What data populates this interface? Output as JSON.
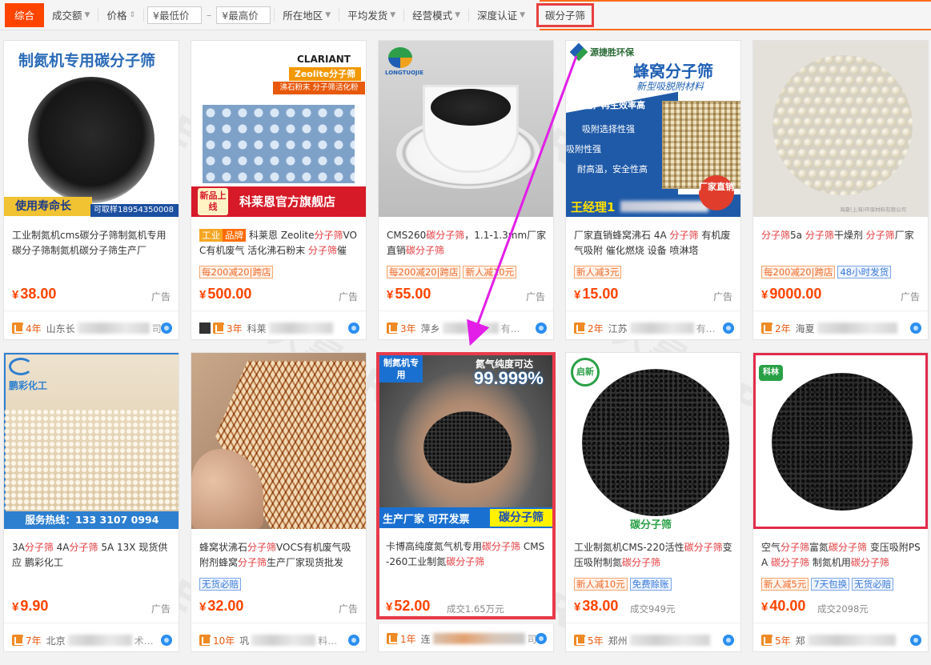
{
  "filter_bar": {
    "items": [
      "综合",
      "成交额",
      "价格"
    ],
    "min_price": "¥最低价",
    "max_price": "¥最高价",
    "location": "所在地区",
    "shipping": "平均发货",
    "business": "经营模式",
    "certification": "深度认证",
    "keyword": "碳分子筛"
  },
  "watermark": "大昇ERP",
  "products": [
    {
      "img_caption": "制氮机专用碳分子筛",
      "img_banner": "使用寿命长",
      "img_banner2": "可取样18954350008",
      "title_parts": [
        "工业制氮机cms碳分子筛制氮机专用碳分子筛制氮机碳分子筛生产厂"
      ],
      "tags": [],
      "price": "38.00",
      "deal": "",
      "ad": "广告",
      "years": "4年",
      "seller": "山东长"
    },
    {
      "img_brand": "CLARIANT",
      "img_sub": "Zeolite分子筛",
      "img_sub2": "沸石粉末 分子筛活化粉",
      "img_badge": "新品上线",
      "img_store": "科莱恩官方旗舰店",
      "title_prefix_tags": [
        "工业",
        "品牌"
      ],
      "title_parts": [
        "科莱恩 Zeolite",
        "分子筛",
        "VOC有机废气 活化沸石粉末 ",
        "分子筛",
        "催"
      ],
      "tags": [
        {
          "text": "每200减20|跨店",
          "style": "orange"
        }
      ],
      "price": "500.00",
      "deal": "",
      "ad": "广告",
      "years": "3年",
      "seller": "科莱"
    },
    {
      "img_logo": "LONGTUOJIE",
      "title_parts": [
        "CMS260",
        "碳分子筛",
        "，1.1-1.3mm厂家直销",
        "碳分子筛"
      ],
      "tags": [
        {
          "text": "每200减20|跨店",
          "style": "orange"
        },
        {
          "text": "新人减10元",
          "style": "orange"
        }
      ],
      "price": "55.00",
      "deal": "",
      "ad": "广告",
      "years": "3年",
      "seller": "萍乡",
      "seller_tail": "有…"
    },
    {
      "img_brand": "源捷胜环保",
      "img_title": "蜂窝分子筛",
      "img_sub": "新型吸脱附材料",
      "img_lines": [
        "热再生，再生效率高",
        "吸附选择性强",
        "吸附性强",
        "耐高温，安全性高"
      ],
      "img_contact": "王经理1",
      "img_badge": "厂家直销",
      "title_parts": [
        "厂家直销蜂窝沸石 4A ",
        "分子筛",
        " 有机废气吸附 催化燃烧 设备 喷淋塔"
      ],
      "tags": [
        {
          "text": "新人减3元",
          "style": "orange"
        }
      ],
      "price": "15.00",
      "deal": "",
      "ad": "广告",
      "years": "2年",
      "seller": "江苏",
      "seller_tail": "有…"
    },
    {
      "img_caption": "海夏(上海)环保材料有限公司",
      "title_parts": [
        "分子筛",
        "5a ",
        "分子筛",
        "干燥剂 ",
        "分子筛",
        "厂家"
      ],
      "tags": [
        {
          "text": "每200减20|跨店",
          "style": "orange"
        },
        {
          "text": "48小时发货",
          "style": "blue"
        }
      ],
      "price": "9000.00",
      "deal": "",
      "ad": "广告",
      "years": "2年",
      "seller": "海夏"
    },
    {
      "img_brand": "鹏彩化工",
      "img_banner": "服务热线：133 3107 0994",
      "title_parts": [
        "3A",
        "分子筛",
        " 4A",
        "分子筛",
        " 5A 13X 现货供应 鹏彩化工"
      ],
      "tags": [],
      "price": "9.90",
      "deal": "",
      "ad": "广告",
      "years": "7年",
      "seller": "北京",
      "seller_tail": "术…"
    },
    {
      "title_parts": [
        "蜂窝状沸石",
        "分子筛",
        "VOCS有机废气吸附剂蜂窝",
        "分子筛",
        "生产厂家现货批发"
      ],
      "tags": [
        {
          "text": "无货必赔",
          "style": "blue"
        }
      ],
      "price": "32.00",
      "deal": "",
      "ad": "广告",
      "years": "10年",
      "seller": "巩",
      "seller_tail": "料…"
    },
    {
      "img_tl": "制氮机专用",
      "img_tr": "氮气纯度可达",
      "img_pct": "99.999%",
      "img_bottom": "生产厂家 可开发票",
      "img_bottom2": "碳分子筛",
      "title_parts": [
        "卡博高纯度氮气机专用",
        "碳分子筛",
        " CMS-260工业制氮",
        "碳分子筛"
      ],
      "tags": [],
      "price": "52.00",
      "deal": "成交1.65万元",
      "ad": "",
      "years": "1年",
      "seller": "连",
      "seller_tail": "司"
    },
    {
      "img_logo": "启新",
      "img_caption": "碳分子筛",
      "title_parts": [
        "工业制氮机CMS-220活性",
        "碳分子筛",
        "变压吸附制氮",
        "碳分子筛"
      ],
      "tags": [
        {
          "text": "新人减10元",
          "style": "orange"
        },
        {
          "text": "免费赊账",
          "style": "blue"
        }
      ],
      "price": "38.00",
      "deal": "成交949元",
      "ad": "",
      "years": "5年",
      "seller": "郑州"
    },
    {
      "img_logo": "科林",
      "title_parts": [
        "空气",
        "分子筛",
        "富氮",
        "碳分子筛",
        " 变压吸附PSA ",
        "碳分子筛",
        " 制氮机用",
        "碳分子筛"
      ],
      "tags": [
        {
          "text": "新人减5元",
          "style": "orange"
        },
        {
          "text": "7天包换",
          "style": "blue"
        },
        {
          "text": "无货必赔",
          "style": "blue"
        }
      ],
      "price": "40.00",
      "deal": "成交2098元",
      "ad": "",
      "years": "5年",
      "seller": "郑"
    }
  ]
}
